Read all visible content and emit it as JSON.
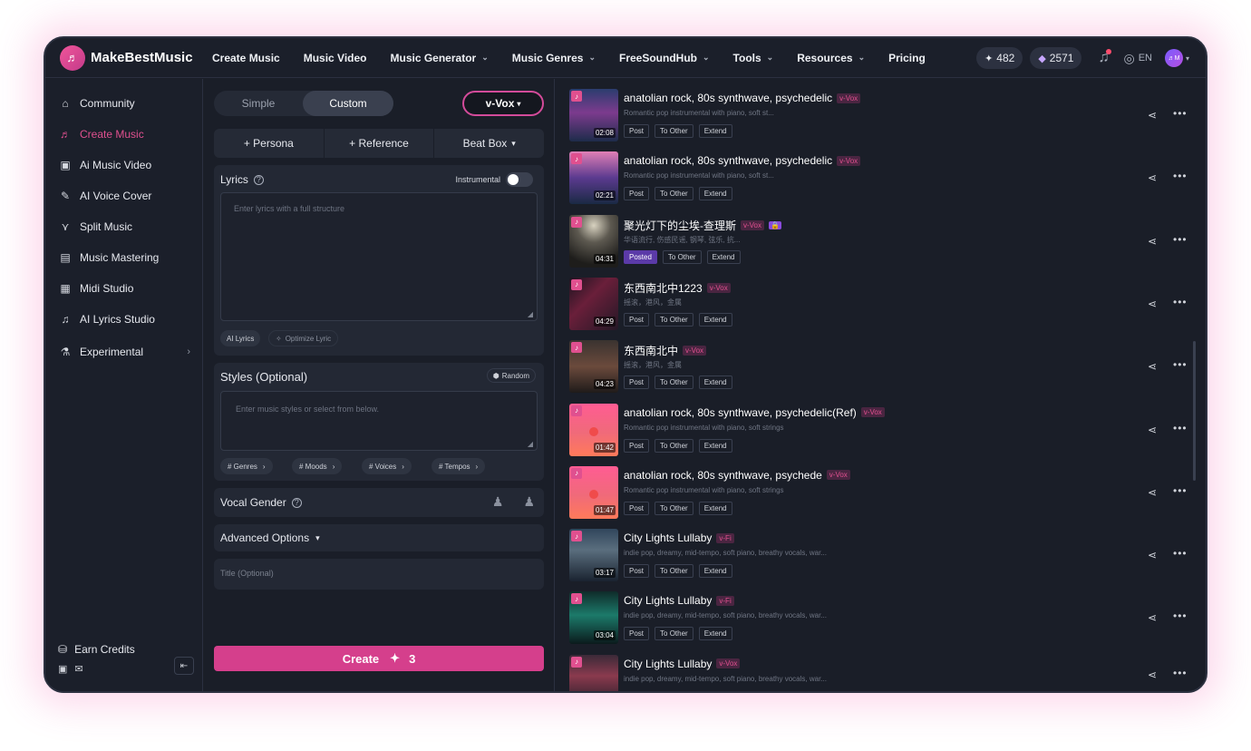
{
  "brand": {
    "name": "MakeBestMusic",
    "logo_glyph": "♬"
  },
  "nav": {
    "items": [
      {
        "label": "Create Music",
        "dropdown": false
      },
      {
        "label": "Music Video",
        "dropdown": false
      },
      {
        "label": "Music Generator",
        "dropdown": true
      },
      {
        "label": "Music Genres",
        "dropdown": true
      },
      {
        "label": "FreeSoundHub",
        "dropdown": true
      },
      {
        "label": "Tools",
        "dropdown": true
      },
      {
        "label": "Resources",
        "dropdown": true
      },
      {
        "label": "Pricing",
        "dropdown": false
      }
    ]
  },
  "topright": {
    "credits": "482",
    "gems": "2571",
    "language": "EN",
    "avatar_text": "♬M"
  },
  "sidebar": {
    "items": [
      {
        "label": "Community",
        "icon": "community-icon",
        "glyph": "⌂",
        "active": false
      },
      {
        "label": "Create Music",
        "icon": "music-note-icon",
        "glyph": "♬",
        "active": true
      },
      {
        "label": "Ai Music Video",
        "icon": "video-icon",
        "glyph": "▣",
        "active": false
      },
      {
        "label": "AI Voice Cover",
        "icon": "microphone-icon",
        "glyph": "✎",
        "active": false
      },
      {
        "label": "Split Music",
        "icon": "split-icon",
        "glyph": "⋎",
        "active": false
      },
      {
        "label": "Music Mastering",
        "icon": "mastering-icon",
        "glyph": "▤",
        "active": false
      },
      {
        "label": "Midi Studio",
        "icon": "midi-icon",
        "glyph": "▦",
        "active": false
      },
      {
        "label": "AI Lyrics Studio",
        "icon": "lyrics-icon",
        "glyph": "♫",
        "active": false
      },
      {
        "label": "Experimental",
        "icon": "flask-icon",
        "glyph": "⚗",
        "active": false
      }
    ],
    "earn_credits": "Earn Credits"
  },
  "form": {
    "mode_simple": "Simple",
    "mode_custom": "Custom",
    "model": "v-Vox",
    "persona": "+ Persona",
    "reference": "+ Reference",
    "beatbox": "Beat Box",
    "lyrics_label": "Lyrics",
    "instrumental": "Instrumental",
    "lyrics_placeholder": "Enter lyrics with a full structure",
    "ai_lyrics": "AI Lyrics",
    "optimize": "Optimize Lyric",
    "styles_label": "Styles (Optional)",
    "random": "Random",
    "styles_placeholder": "Enter music styles or select from below.",
    "tags": [
      "# Genres",
      "# Moods",
      "# Voices",
      "# Tempos"
    ],
    "vocal_gender": "Vocal Gender",
    "advanced": "Advanced Options",
    "title_placeholder": "Title (Optional)",
    "create": "Create",
    "create_cost": "3"
  },
  "songs": [
    {
      "title": "anatolian rock, 80s synthwave, psychedelic",
      "tag": "v-Vox",
      "desc": "Romantic pop instrumental with piano, soft st...",
      "duration": "02:08",
      "post": "Post",
      "posted": false,
      "locked": false,
      "theme": "arch",
      "reddot": false
    },
    {
      "title": "anatolian rock, 80s synthwave, psychedelic",
      "tag": "v-Vox",
      "desc": "Romantic pop instrumental with piano, soft st...",
      "duration": "02:21",
      "post": "Post",
      "posted": false,
      "locked": false,
      "theme": "arch2",
      "reddot": false
    },
    {
      "title": "聚光灯下的尘埃-查理斯",
      "tag": "v-Vox",
      "desc": "华语流行, 伤感民谣, 钢琴, 弦乐, 抗...",
      "duration": "04:31",
      "post": "Posted",
      "posted": true,
      "locked": true,
      "theme": "spot",
      "reddot": false
    },
    {
      "title": "东西南北中1223",
      "tag": "v-Vox",
      "desc": "摇滚，港风，金属",
      "duration": "04:29",
      "post": "Post",
      "posted": false,
      "locked": false,
      "theme": "neon",
      "reddot": false
    },
    {
      "title": "东西南北中",
      "tag": "v-Vox",
      "desc": "摇滚，港风，金属",
      "duration": "04:23",
      "post": "Post",
      "posted": false,
      "locked": false,
      "theme": "street",
      "reddot": false
    },
    {
      "title": "anatolian rock, 80s synthwave, psychedelic(Ref)",
      "tag": "v-Vox",
      "desc": "Romantic pop instrumental with piano, soft strings",
      "duration": "01:42",
      "post": "Post",
      "posted": false,
      "locked": false,
      "theme": "pink",
      "reddot": true
    },
    {
      "title": "anatolian rock, 80s synthwave, psychedе",
      "tag": "v-Vox",
      "desc": "Romantic pop instrumental with piano, soft strings",
      "duration": "01:47",
      "post": "Post",
      "posted": false,
      "locked": false,
      "theme": "pink",
      "reddot": true
    },
    {
      "title": "City Lights Lullaby",
      "tag": "v-Fi",
      "desc": "indie pop, dreamy, mid-tempo, soft piano, breathy vocals, war...",
      "duration": "03:17",
      "post": "Post",
      "posted": false,
      "locked": false,
      "theme": "city",
      "reddot": false
    },
    {
      "title": "City Lights Lullaby",
      "tag": "v-Fi",
      "desc": "indie pop, dreamy, mid-tempo, soft piano, breathy vocals, war...",
      "duration": "03:04",
      "post": "Post",
      "posted": false,
      "locked": false,
      "theme": "teal",
      "reddot": false
    },
    {
      "title": "City Lights Lullaby",
      "tag": "v-Vox",
      "desc": "indie pop, dreamy, mid-tempo, soft piano, breathy vocals, war...",
      "duration": "",
      "post": "",
      "posted": false,
      "locked": false,
      "theme": "city2",
      "reddot": false
    }
  ],
  "song_actions": {
    "to_other": "To Other",
    "extend": "Extend"
  },
  "colors": {
    "accent": "#e0508f",
    "create_button": "#d53f8c",
    "background": "#1a1e28"
  }
}
